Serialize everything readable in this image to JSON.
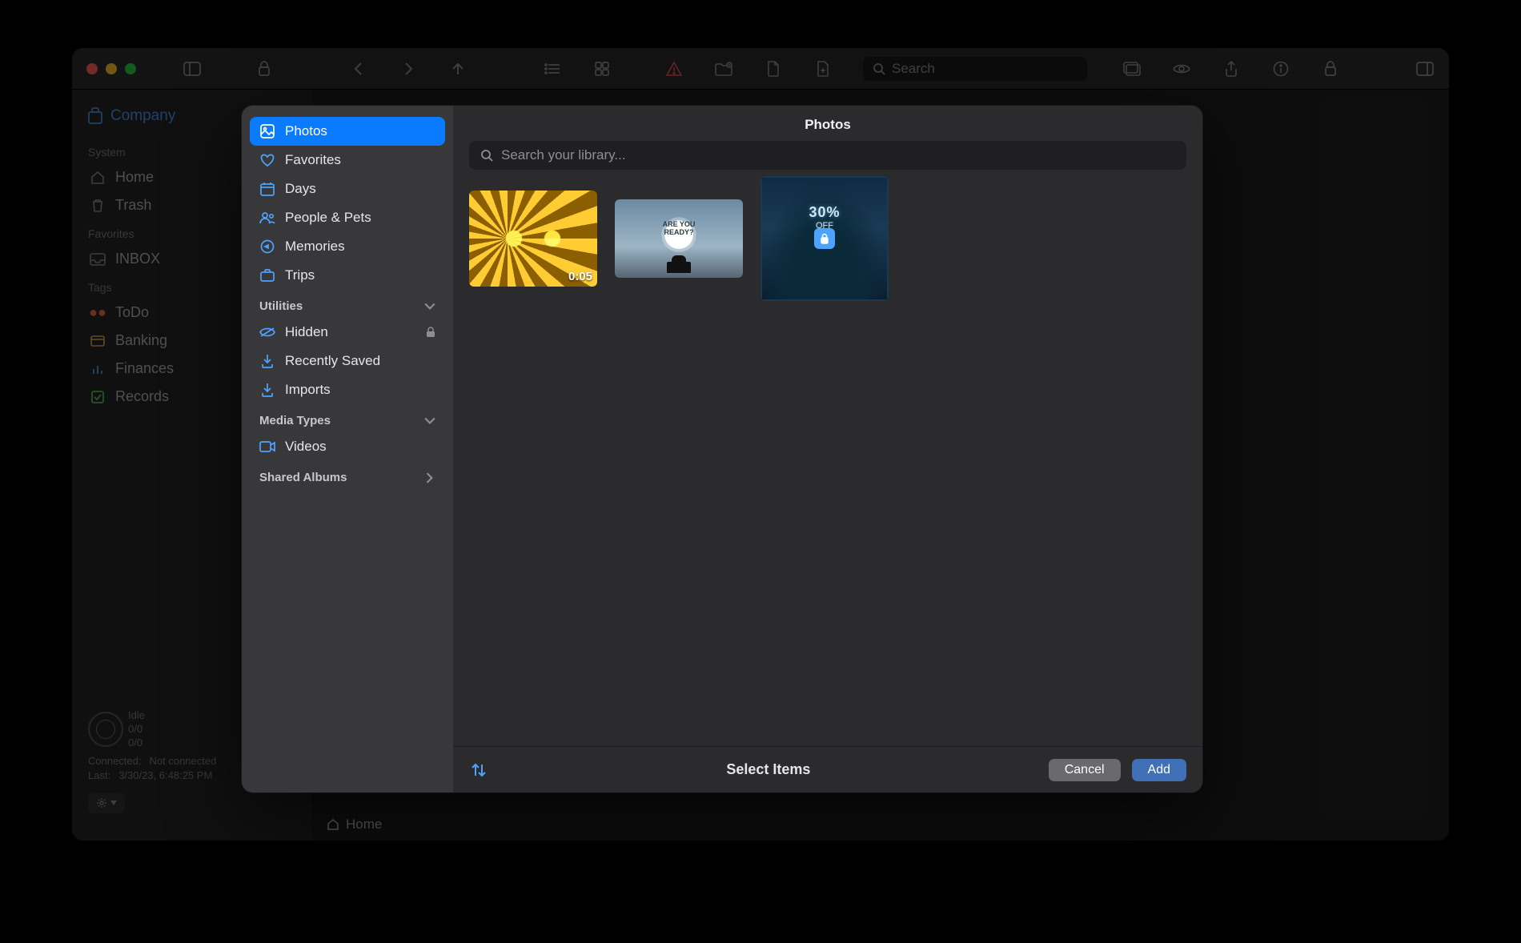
{
  "bg": {
    "company": "Company",
    "search_placeholder": "Search",
    "sections": {
      "system": {
        "label": "System",
        "items": [
          "Home",
          "Trash"
        ]
      },
      "favorites": {
        "label": "Favorites",
        "items": [
          "INBOX"
        ]
      },
      "tags": {
        "label": "Tags",
        "items": [
          "ToDo",
          "Banking",
          "Finances",
          "Records"
        ]
      }
    },
    "status": {
      "idle": "Idle",
      "ratio1": "0/0",
      "ratio2": "0/0",
      "connected_label": "Connected:",
      "connected_value": "Not connected",
      "last_label": "Last:",
      "last_value": "3/30/23, 6:48:25 PM"
    },
    "breadcrumb": "Home"
  },
  "picker": {
    "title": "Photos",
    "search_placeholder": "Search your library...",
    "sidebar": {
      "main": [
        {
          "icon": "photos",
          "label": "Photos",
          "selected": true
        },
        {
          "icon": "heart",
          "label": "Favorites"
        },
        {
          "icon": "calendar",
          "label": "Days"
        },
        {
          "icon": "people",
          "label": "People & Pets"
        },
        {
          "icon": "memories",
          "label": "Memories"
        },
        {
          "icon": "trips",
          "label": "Trips"
        }
      ],
      "utilities": {
        "label": "Utilities",
        "items": [
          {
            "icon": "hidden",
            "label": "Hidden",
            "locked": true
          },
          {
            "icon": "saved",
            "label": "Recently Saved"
          },
          {
            "icon": "imports",
            "label": "Imports"
          }
        ]
      },
      "media": {
        "label": "Media Types",
        "items": [
          {
            "icon": "video",
            "label": "Videos"
          }
        ]
      },
      "shared": {
        "label": "Shared Albums"
      }
    },
    "thumbs": [
      {
        "duration": "0:05"
      },
      {
        "overlay": "ARE YOU READY?"
      },
      {
        "overlay": "30%",
        "overlay_sub": "OFF"
      }
    ],
    "footer": {
      "title": "Select Items",
      "cancel": "Cancel",
      "add": "Add"
    }
  }
}
